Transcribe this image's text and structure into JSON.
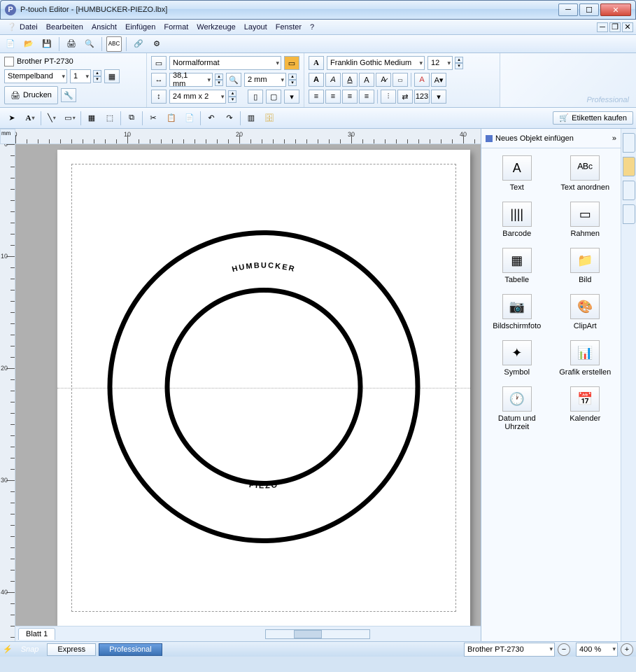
{
  "window": {
    "app": "P-touch Editor",
    "doc": "[HUMBUCKER-PIEZO.lbx]"
  },
  "menu": [
    "Datei",
    "Bearbeiten",
    "Ansicht",
    "Einfügen",
    "Format",
    "Werkzeuge",
    "Layout",
    "Fenster",
    "?"
  ],
  "printer_panel": {
    "printer": "Brother PT-2730",
    "media": "Stempelband",
    "copies": "1",
    "print_btn": "Drucken"
  },
  "format_panel": {
    "format": "Normalformat",
    "width": "38,1 mm",
    "margin": "2 mm",
    "tape": "24 mm x 2"
  },
  "font_panel": {
    "font": "Franklin Gothic Medium",
    "size": "12"
  },
  "brand": "Professional",
  "buy_btn": "Etiketten kaufen",
  "side": {
    "title": "Neues Objekt einfügen",
    "items": [
      {
        "label": "Text",
        "glyph": "A"
      },
      {
        "label": "Text anordnen",
        "glyph": "ᴬᴮᶜ"
      },
      {
        "label": "Barcode",
        "glyph": "||||"
      },
      {
        "label": "Rahmen",
        "glyph": "▭"
      },
      {
        "label": "Tabelle",
        "glyph": "▦"
      },
      {
        "label": "Bild",
        "glyph": "📁"
      },
      {
        "label": "Bildschirmfoto",
        "glyph": "📷"
      },
      {
        "label": "ClipArt",
        "glyph": "🎨"
      },
      {
        "label": "Symbol",
        "glyph": "✦"
      },
      {
        "label": "Grafik erstellen",
        "glyph": "📊"
      },
      {
        "label": "Datum und Uhrzeit",
        "glyph": "🕐"
      },
      {
        "label": "Kalender",
        "glyph": "📅"
      }
    ]
  },
  "canvas": {
    "ruler_unit": "mm",
    "tape_label_line1": "24 mm",
    "tape_label_line2": "x 2",
    "text_top": "HUMBUCKER",
    "text_bottom": "PIEZO",
    "sheet": "Blatt 1"
  },
  "status": {
    "snap": "Snap",
    "modes": [
      "Express",
      "Professional"
    ],
    "active_mode": "Professional",
    "printer": "Brother PT-2730",
    "zoom": "400 %"
  }
}
